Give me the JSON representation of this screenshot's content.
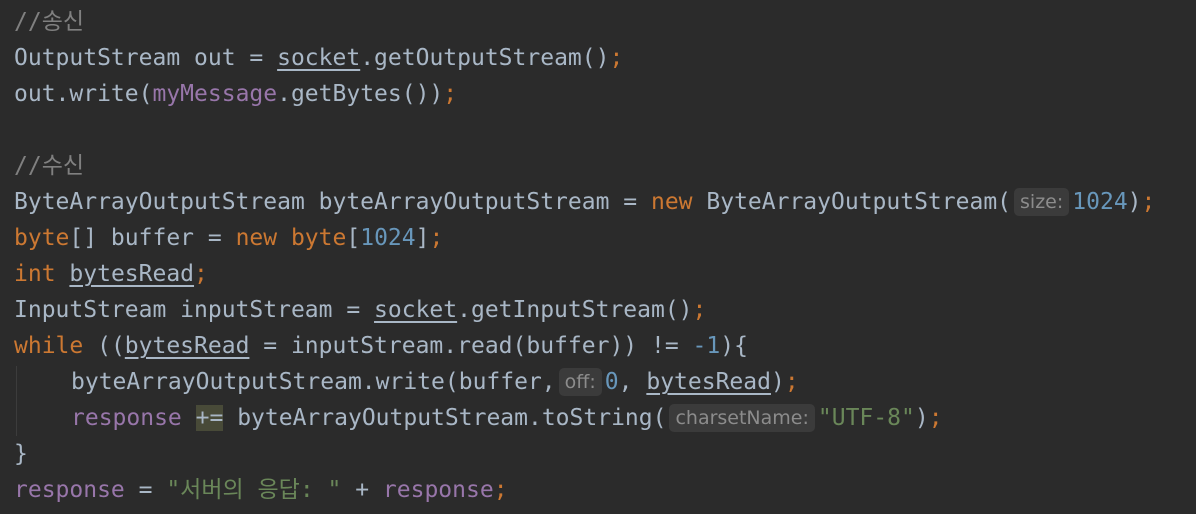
{
  "code": {
    "l1": {
      "comment": "//송신"
    },
    "l2": {
      "t1": "OutputStream out = ",
      "socket": "socket",
      "t2": ".getOutputStream()",
      "semi": ";"
    },
    "l3": {
      "t1": "out.write(",
      "field": "myMessage",
      "t2": ".getBytes())",
      "semi": ";"
    },
    "l5": {
      "comment": "//수신"
    },
    "l6": {
      "t1": "ByteArrayOutputStream byteArrayOutputStream = ",
      "kw": "new",
      "t2": " ByteArrayOutputStream(",
      "hint": "size:",
      "num": "1024",
      "t3": ")",
      "semi": ";"
    },
    "l7": {
      "kw1": "byte",
      "t1": "[] buffer = ",
      "kw2": "new",
      "kw3": " byte",
      "t2": "[",
      "num": "1024",
      "t3": "]",
      "semi": ";"
    },
    "l8": {
      "kw": "int",
      "t1": " ",
      "var": "bytesRead",
      "semi": ";"
    },
    "l9": {
      "t1": "InputStream inputStream = ",
      "socket": "socket",
      "t2": ".getInputStream()",
      "semi": ";"
    },
    "l10": {
      "kw": "while",
      "t1": " ((",
      "var": "bytesRead",
      "t2": " = inputStream.read(buffer)) != ",
      "num": "-1",
      "t3": "){"
    },
    "l11": {
      "t1": "byteArrayOutputStream.write(buffer,",
      "hint": "off:",
      "num": "0",
      "t2": ", ",
      "var": "bytesRead",
      "t3": ")",
      "semi": ";"
    },
    "l12": {
      "field": "response",
      "t1": " ",
      "op": "+=",
      "t2": " byteArrayOutputStream.toString(",
      "hint": "charsetName:",
      "str": "\"UTF-8\"",
      "t3": ")",
      "semi": ";"
    },
    "l13": {
      "t1": "}"
    },
    "l14": {
      "field1": "response",
      "t1": " = ",
      "str": "\"서버의 응답: \"",
      "t2": " + ",
      "field2": "response",
      "semi": ";"
    }
  }
}
